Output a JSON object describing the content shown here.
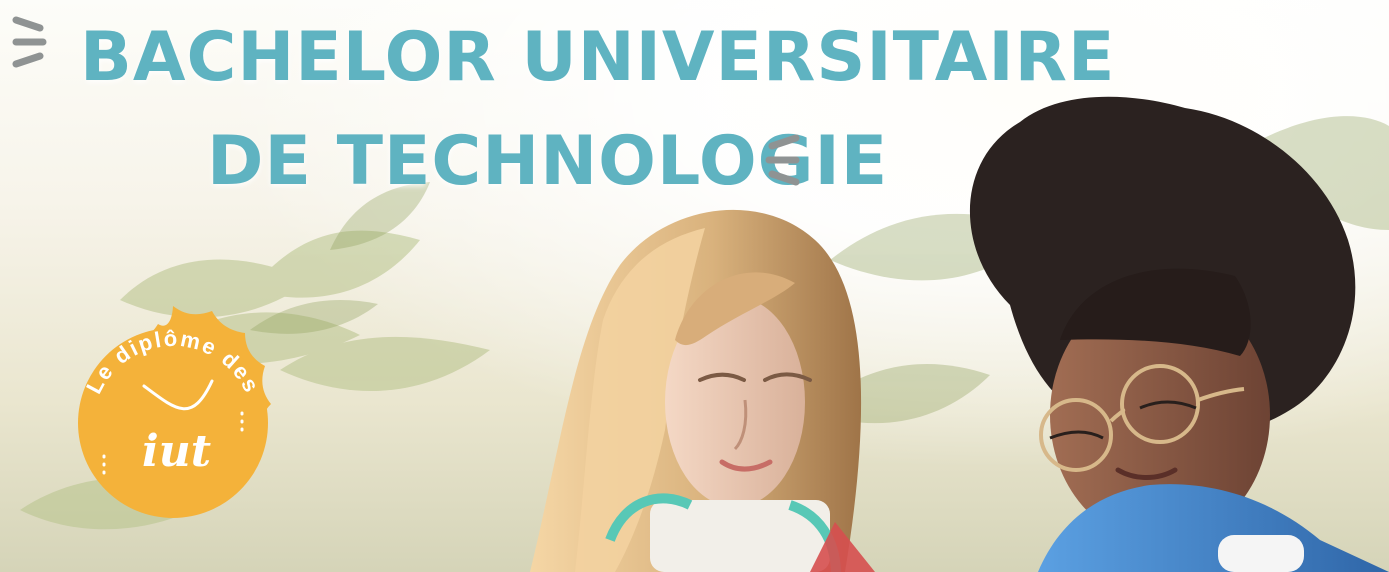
{
  "banner": {
    "title_line1": "Bachelor Universitaire",
    "title_line2": "de Technologie",
    "badge_arc_text": "Le diplôme des",
    "badge_logo_text": "iut"
  },
  "colors": {
    "title": "#5fb3c1",
    "badge": "#f4b23a",
    "badge_text": "#ffffff",
    "dashes": "#8f9393"
  },
  "icons": {
    "left_dashes": "triple-dash-icon",
    "right_dashes": "triple-dash-icon"
  }
}
